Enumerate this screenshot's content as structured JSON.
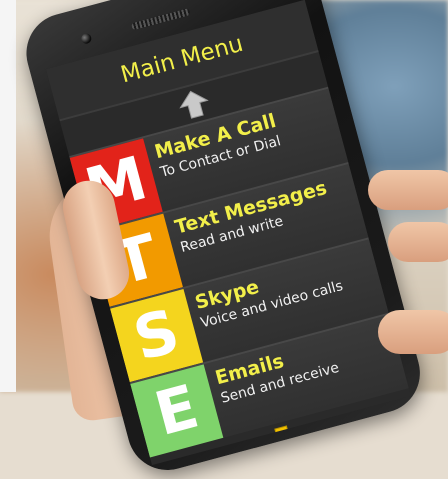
{
  "screen": {
    "title": "Main Menu",
    "items": [
      {
        "letter": "M",
        "label": "Make A Call",
        "sub": "To Contact or Dial",
        "color": "#e2231a"
      },
      {
        "letter": "T",
        "label": "Text Messages",
        "sub": "Read and write",
        "color": "#f29a00"
      },
      {
        "letter": "S",
        "label": "Skype",
        "sub": "Voice and video calls",
        "color": "#f4d51e"
      },
      {
        "letter": "E",
        "label": "Emails",
        "sub": "Send and receive",
        "color": "#7fd36b"
      }
    ],
    "nav": {
      "up_icon": "arrow-up-icon",
      "down_icon": "arrow-down-icon"
    },
    "colors": {
      "title": "#f2ef4a",
      "up_arrow": "#c9c9c9",
      "down_arrow": "#f2c200"
    }
  }
}
